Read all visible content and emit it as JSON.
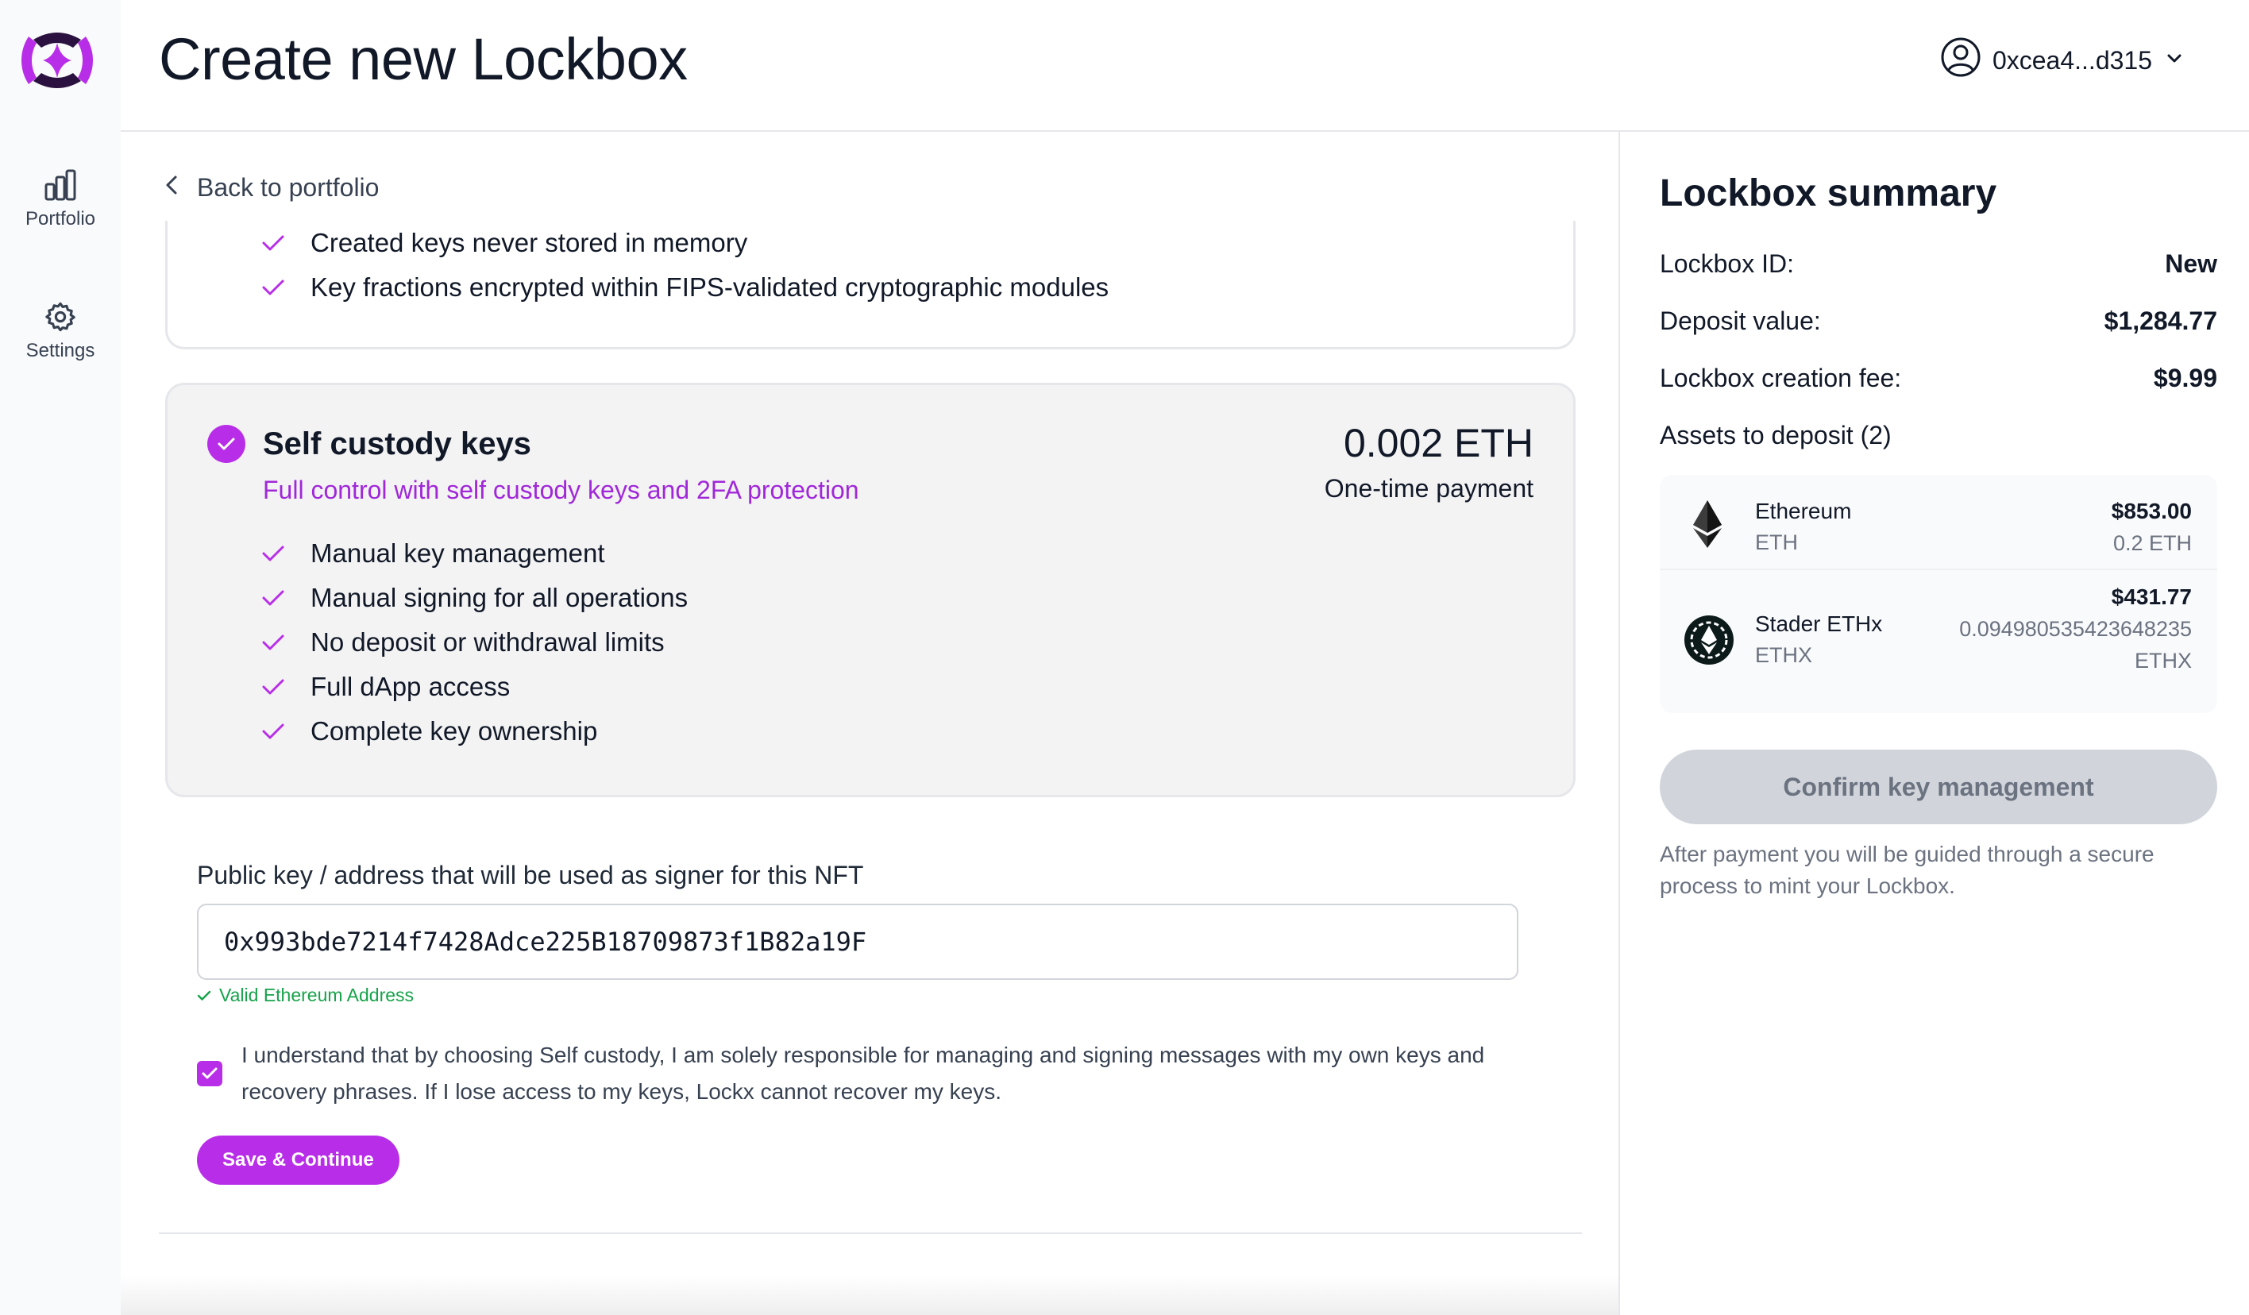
{
  "nav": {
    "items": [
      {
        "label": "Portfolio",
        "icon": "bar-chart-icon"
      },
      {
        "label": "Settings",
        "icon": "gear-icon"
      }
    ]
  },
  "header": {
    "title": "Create new Lockbox",
    "account": "0xcea4...d315"
  },
  "main": {
    "back_label": "Back to portfolio",
    "prev_features": [
      "Created keys never stored in memory",
      "Key fractions encrypted within FIPS-validated cryptographic modules"
    ],
    "self_custody": {
      "title": "Self custody keys",
      "subtitle": "Full control with self custody keys and 2FA protection",
      "price": "0.002 ETH",
      "price_note": "One-time payment",
      "features": [
        "Manual key management",
        "Manual signing for all operations",
        "No deposit or withdrawal limits",
        "Full dApp access",
        "Complete key ownership"
      ]
    },
    "address_label": "Public key / address that will be used as signer for this NFT",
    "address_value": "0x993bde7214f7428Adce225B18709873f1B82a19F",
    "valid_message": "Valid Ethereum Address",
    "consent_text": "I understand that by choosing Self custody, I am solely responsible for managing and signing messages with my own keys and recovery phrases. If I lose access to my keys, Lockx cannot recover my keys.",
    "consent_checked": true,
    "save_label": "Save & Continue"
  },
  "summary": {
    "title": "Lockbox summary",
    "rows": [
      {
        "label": "Lockbox ID:",
        "value": "New"
      },
      {
        "label": "Deposit value:",
        "value": "$1,284.77"
      },
      {
        "label": "Lockbox creation fee:",
        "value": "$9.99"
      }
    ],
    "assets_label": "Assets to deposit (2)",
    "assets": [
      {
        "name": "Ethereum",
        "symbol": "ETH",
        "usd": "$853.00",
        "amount": "0.2 ETH",
        "icon": "ethereum-icon"
      },
      {
        "name": "Stader ETHx",
        "symbol": "ETHX",
        "usd": "$431.77",
        "amount": "0.094980535423648235 ETHX",
        "icon": "stader-ethx-icon"
      }
    ],
    "confirm_label": "Confirm key management",
    "confirm_note": "After payment you will be guided through a secure process to mint your Lockbox."
  },
  "colors": {
    "accent": "#b82ee8",
    "accent_text": "#a028d8",
    "success": "#16a34a",
    "disabled_button": "#d1d5db"
  }
}
